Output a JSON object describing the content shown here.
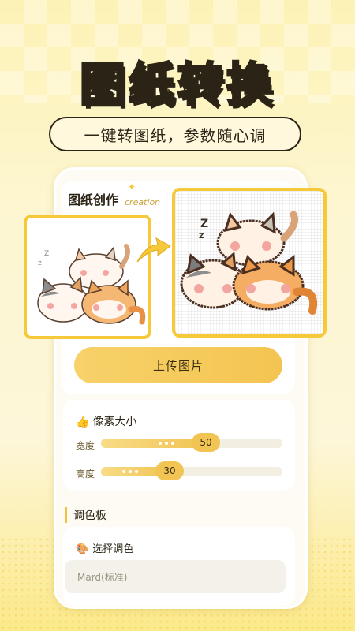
{
  "hero": {
    "title": "图纸转换",
    "subtitle": "一键转图纸，参数随心调"
  },
  "creation": {
    "title": "图纸创作",
    "subtitle": "creation",
    "original_image_label": "cats-illustration",
    "converted_image_label": "cats-pixel-pattern",
    "upload_label": "上传图片"
  },
  "pixel_size": {
    "title": "像素大小",
    "icon": "thumbs-up-icon",
    "width_label": "宽度",
    "width_value": "50",
    "width_fraction": 0.58,
    "height_label": "高度",
    "height_value": "30",
    "height_fraction": 0.38
  },
  "palette": {
    "section_title": "调色板",
    "select_label": "选择调色",
    "icon": "palette-icon",
    "selected_value": "Mard(标准)"
  },
  "colors": {
    "accent": "#f5c93a",
    "outline": "#2b2416",
    "title_fill": "#ffd93a"
  }
}
